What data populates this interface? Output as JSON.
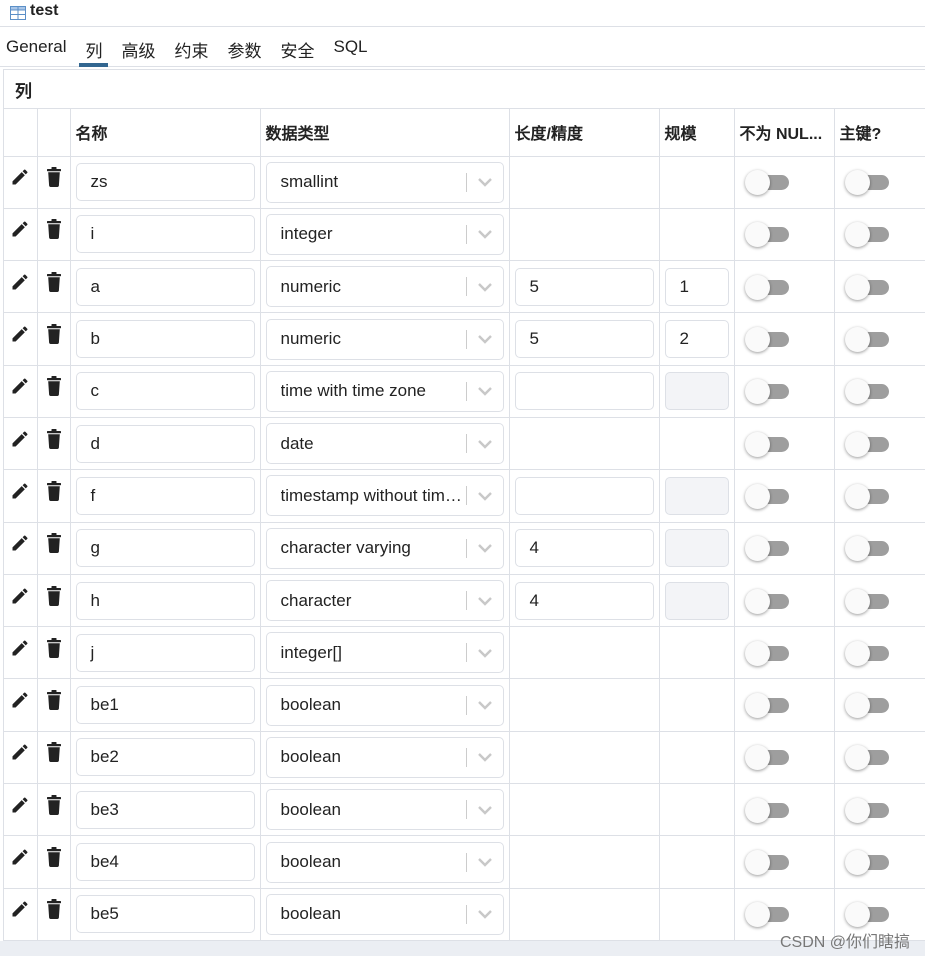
{
  "window": {
    "title": "test",
    "icon": "table-icon"
  },
  "tabs": [
    {
      "label": "General",
      "active": false
    },
    {
      "label": "列",
      "active": true
    },
    {
      "label": "高级",
      "active": false
    },
    {
      "label": "约束",
      "active": false
    },
    {
      "label": "参数",
      "active": false
    },
    {
      "label": "安全",
      "active": false
    },
    {
      "label": "SQL",
      "active": false
    }
  ],
  "panel": {
    "title": "列",
    "columns": [
      "",
      "",
      "名称",
      "数据类型",
      "长度/精度",
      "规模",
      "不为 NUL...",
      "主键?"
    ],
    "rows": [
      {
        "name": "zs",
        "type": "smallint",
        "length": null,
        "scale": null,
        "not_null": false,
        "primary_key": false
      },
      {
        "name": "i",
        "type": "integer",
        "length": null,
        "scale": null,
        "not_null": false,
        "primary_key": false
      },
      {
        "name": "a",
        "type": "numeric",
        "length": "5",
        "scale": "1",
        "not_null": false,
        "primary_key": false
      },
      {
        "name": "b",
        "type": "numeric",
        "length": "5",
        "scale": "2",
        "not_null": false,
        "primary_key": false
      },
      {
        "name": "c",
        "type": "time with time zone",
        "length": "",
        "scale": "disabled",
        "not_null": false,
        "primary_key": false
      },
      {
        "name": "d",
        "type": "date",
        "length": null,
        "scale": null,
        "not_null": false,
        "primary_key": false
      },
      {
        "name": "f",
        "type": "timestamp without time zone",
        "length": "",
        "scale": "disabled",
        "not_null": false,
        "primary_key": false
      },
      {
        "name": "g",
        "type": "character varying",
        "length": "4",
        "scale": "disabled",
        "not_null": false,
        "primary_key": false
      },
      {
        "name": "h",
        "type": "character",
        "length": "4",
        "scale": "disabled",
        "not_null": false,
        "primary_key": false
      },
      {
        "name": "j",
        "type": "integer[]",
        "length": null,
        "scale": null,
        "not_null": false,
        "primary_key": false
      },
      {
        "name": "be1",
        "type": "boolean",
        "length": null,
        "scale": null,
        "not_null": false,
        "primary_key": false
      },
      {
        "name": "be2",
        "type": "boolean",
        "length": null,
        "scale": null,
        "not_null": false,
        "primary_key": false
      },
      {
        "name": "be3",
        "type": "boolean",
        "length": null,
        "scale": null,
        "not_null": false,
        "primary_key": false
      },
      {
        "name": "be4",
        "type": "boolean",
        "length": null,
        "scale": null,
        "not_null": false,
        "primary_key": false
      },
      {
        "name": "be5",
        "type": "boolean",
        "length": null,
        "scale": null,
        "not_null": false,
        "primary_key": false
      }
    ]
  },
  "watermark": "CSDN @你们瞎搞",
  "colors": {
    "accent": "#326690",
    "border": "#dde0e6",
    "toggle_track": "#9e9e9e",
    "disabled_bg": "#f3f4f7"
  }
}
